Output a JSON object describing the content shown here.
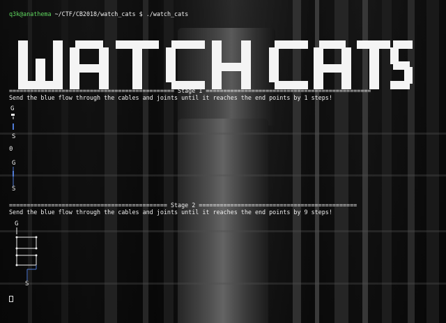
{
  "prompt": {
    "user_host": "q3k@anathema",
    "path": "~/CTF/CB2018/watch_cats",
    "symbol": "$",
    "command": "./watch_cats"
  },
  "banner": {
    "text": "WATCH CATS"
  },
  "stage1": {
    "header": "=============================================== Stage 1 ===============================================",
    "instruction": "Send the blue flow through the cables and joints until it reaches the end points by 1 steps!",
    "start_label": "G",
    "end_label": "S",
    "step_count": "0",
    "after_start_label": "G",
    "after_end_label": "S"
  },
  "stage2": {
    "header": "============================================= Stage 2 =============================================",
    "instruction": "Send the blue flow through the cables and joints until it reaches the end points by 9 steps!",
    "start_label": "G",
    "end_label": "S"
  },
  "colors": {
    "prompt_user": "#5fd75f",
    "flow": "#4f7bd6",
    "text": "#f0f0f0"
  },
  "icons": {
    "cursor": "block-cursor"
  }
}
